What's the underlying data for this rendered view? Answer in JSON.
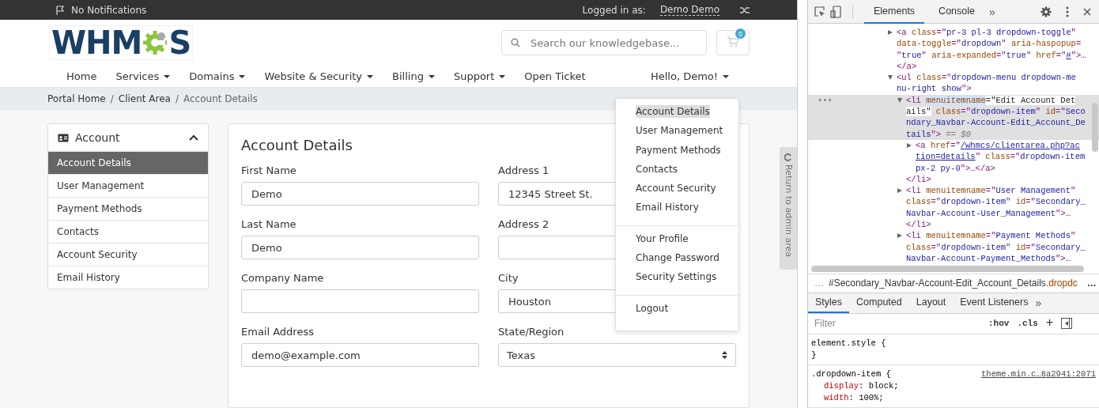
{
  "topbar": {
    "notifications": "No Notifications",
    "logged_in_label": "Logged in as:",
    "user": "Demo Demo"
  },
  "logo": {
    "before": "WHM",
    "after": "S"
  },
  "search": {
    "placeholder": "Search our knowledgebase..."
  },
  "cart": {
    "count": "0"
  },
  "nav": [
    {
      "label": "Home",
      "dropdown": false
    },
    {
      "label": "Services",
      "dropdown": true
    },
    {
      "label": "Domains",
      "dropdown": true
    },
    {
      "label": "Website & Security",
      "dropdown": true
    },
    {
      "label": "Billing",
      "dropdown": true
    },
    {
      "label": "Support",
      "dropdown": true
    },
    {
      "label": "Open Ticket",
      "dropdown": false
    }
  ],
  "account_menu": {
    "label": "Hello, Demo!",
    "expanded": true
  },
  "breadcrumb": {
    "separator": "/",
    "items": [
      {
        "label": "Portal Home",
        "current": false
      },
      {
        "label": "Client Area",
        "current": false
      },
      {
        "label": "Account Details",
        "current": true
      }
    ]
  },
  "sidebar": {
    "title": "Account",
    "expanded": true,
    "items": [
      {
        "label": "Account Details",
        "selected": true
      },
      {
        "label": "User Management",
        "selected": false
      },
      {
        "label": "Payment Methods",
        "selected": false
      },
      {
        "label": "Contacts",
        "selected": false
      },
      {
        "label": "Account Security",
        "selected": false
      },
      {
        "label": "Email History",
        "selected": false
      }
    ]
  },
  "form": {
    "title": "Account Details",
    "fields": [
      {
        "label": "First Name",
        "value": "Demo",
        "kind": "text"
      },
      {
        "label": "Address 1",
        "value": "12345 Street St.",
        "kind": "text"
      },
      {
        "label": "Last Name",
        "value": "Demo",
        "kind": "text"
      },
      {
        "label": "Address 2",
        "kind": "text"
      },
      {
        "label": "Company Name",
        "kind": "text"
      },
      {
        "label": "City",
        "value": "Houston",
        "kind": "text"
      },
      {
        "label": "Email Address",
        "value": "demo@example.com",
        "kind": "text"
      },
      {
        "label": "State/Region",
        "value": "Texas",
        "kind": "select"
      }
    ]
  },
  "dropdown_menu": [
    [
      {
        "label": "Account Details",
        "selected": true
      },
      {
        "label": "User Management",
        "selected": false
      },
      {
        "label": "Payment Methods",
        "selected": false
      },
      {
        "label": "Contacts",
        "selected": false
      },
      {
        "label": "Account Security",
        "selected": false
      },
      {
        "label": "Email History",
        "selected": false
      }
    ],
    [
      {
        "label": "Your Profile",
        "selected": false
      },
      {
        "label": "Change Password",
        "selected": false
      },
      {
        "label": "Security Settings",
        "selected": false
      }
    ],
    [
      {
        "label": "Logout",
        "selected": false
      }
    ]
  ],
  "admin_tab": "Return to admin area",
  "devtools": {
    "tabs": [
      {
        "label": "Elements",
        "selected": true
      },
      {
        "label": "Console",
        "selected": false
      }
    ],
    "more": "»",
    "dom": [
      {
        "expanded": false,
        "selected": false,
        "lines": [
          [
            {
              "kind": "tag",
              "t": "<a "
            },
            {
              "kind": "attr",
              "t": "class"
            },
            {
              "kind": "tag",
              "t": "=\""
            },
            {
              "kind": "val",
              "t": "pr-3 pl-3 dropdown-toggle"
            },
            {
              "kind": "tag",
              "t": "\""
            }
          ],
          [
            {
              "kind": "attr",
              "t": "data-toggle"
            },
            {
              "kind": "tag",
              "t": "=\""
            },
            {
              "kind": "val",
              "t": "dropdown"
            },
            {
              "kind": "tag",
              "t": "\" "
            },
            {
              "kind": "attr",
              "t": "aria-haspopup"
            },
            {
              "kind": "tag",
              "t": "="
            }
          ],
          [
            {
              "kind": "tag",
              "t": "\""
            },
            {
              "kind": "val",
              "t": "true"
            },
            {
              "kind": "tag",
              "t": "\" "
            },
            {
              "kind": "attr",
              "t": "aria-expanded"
            },
            {
              "kind": "tag",
              "t": "=\""
            },
            {
              "kind": "val",
              "t": "true"
            },
            {
              "kind": "tag",
              "t": "\" "
            },
            {
              "kind": "attr",
              "t": "href"
            },
            {
              "kind": "tag",
              "t": "=\""
            },
            {
              "kind": "link",
              "t": "#"
            },
            {
              "kind": "tag",
              "t": "\">…"
            }
          ]
        ],
        "closing": [
          {
            "kind": "tag",
            "t": "</a>"
          }
        ]
      },
      {
        "expanded": true,
        "selected": false,
        "lines": [
          [
            {
              "kind": "tag",
              "t": "<ul "
            },
            {
              "kind": "attr",
              "t": "class"
            },
            {
              "kind": "tag",
              "t": "=\""
            },
            {
              "kind": "val",
              "t": "dropdown-menu dropdown-me"
            }
          ],
          [
            {
              "kind": "val",
              "t": "nu-right show"
            },
            {
              "kind": "tag",
              "t": "\">"
            }
          ]
        ],
        "children": [
          {
            "expanded": true,
            "selected": true,
            "gutter": "•••",
            "lines": [
              [
                {
                  "kind": "tag",
                  "t": "<li "
                },
                {
                  "kind": "edit-attr",
                  "t": "menuitemname"
                },
                {
                  "kind": "edit",
                  "t": "=\"Edit Account Det"
                }
              ],
              [
                {
                  "kind": "edit",
                  "t": "ails\""
                },
                {
                  "kind": "attr",
                  "t": " class"
                },
                {
                  "kind": "tag",
                  "t": "=\""
                },
                {
                  "kind": "val",
                  "t": "dropdown-item"
                },
                {
                  "kind": "tag",
                  "t": "\" "
                },
                {
                  "kind": "attr",
                  "t": "id"
                },
                {
                  "kind": "tag",
                  "t": "=\""
                },
                {
                  "kind": "val",
                  "t": "Seco"
                }
              ],
              [
                {
                  "kind": "val",
                  "t": "ndary_Navbar-Account-Edit_Account_De"
                }
              ],
              [
                {
                  "kind": "val",
                  "t": "tails"
                },
                {
                  "kind": "tag",
                  "t": "\">"
                },
                {
                  "kind": "note",
                  "t": " == $0"
                }
              ]
            ],
            "closing": [
              {
                "kind": "tag",
                "t": "</li>"
              }
            ],
            "children": [
              {
                "expanded": false,
                "selected": false,
                "lines": [
                  [
                    {
                      "kind": "tag",
                      "t": "<a "
                    },
                    {
                      "kind": "attr",
                      "t": "href"
                    },
                    {
                      "kind": "tag",
                      "t": "=\""
                    },
                    {
                      "kind": "link",
                      "t": "/whmcs/clientarea.php?ac"
                    }
                  ],
                  [
                    {
                      "kind": "link",
                      "t": "tion=details"
                    },
                    {
                      "kind": "tag",
                      "t": "\" "
                    },
                    {
                      "kind": "attr",
                      "t": "class"
                    },
                    {
                      "kind": "tag",
                      "t": "=\""
                    },
                    {
                      "kind": "val",
                      "t": "dropdown-item"
                    }
                  ],
                  [
                    {
                      "kind": "val",
                      "t": "px-2 py-0"
                    },
                    {
                      "kind": "tag",
                      "t": "\">…</a>"
                    }
                  ]
                ]
              }
            ]
          },
          {
            "expanded": false,
            "selected": false,
            "lines": [
              [
                {
                  "kind": "tag",
                  "t": "<li "
                },
                {
                  "kind": "attr",
                  "t": "menuitemname"
                },
                {
                  "kind": "tag",
                  "t": "=\""
                },
                {
                  "kind": "val",
                  "t": "User Management"
                },
                {
                  "kind": "tag",
                  "t": "\""
                }
              ],
              [
                {
                  "kind": "attr",
                  "t": "class"
                },
                {
                  "kind": "tag",
                  "t": "=\""
                },
                {
                  "kind": "val",
                  "t": "dropdown-item"
                },
                {
                  "kind": "tag",
                  "t": "\" "
                },
                {
                  "kind": "attr",
                  "t": "id"
                },
                {
                  "kind": "tag",
                  "t": "=\""
                },
                {
                  "kind": "val",
                  "t": "Secondary_"
                }
              ],
              [
                {
                  "kind": "val",
                  "t": "Navbar-Account-User_Management"
                },
                {
                  "kind": "tag",
                  "t": "\">…"
                }
              ]
            ],
            "closing": [
              {
                "kind": "tag",
                "t": "</li>"
              }
            ]
          },
          {
            "expanded": false,
            "selected": false,
            "lines": [
              [
                {
                  "kind": "tag",
                  "t": "<li "
                },
                {
                  "kind": "attr",
                  "t": "menuitemname"
                },
                {
                  "kind": "tag",
                  "t": "=\""
                },
                {
                  "kind": "val",
                  "t": "Payment Methods"
                },
                {
                  "kind": "tag",
                  "t": "\""
                }
              ],
              [
                {
                  "kind": "attr",
                  "t": "class"
                },
                {
                  "kind": "tag",
                  "t": "=\""
                },
                {
                  "kind": "val",
                  "t": "dropdown-item"
                },
                {
                  "kind": "tag",
                  "t": "\" "
                },
                {
                  "kind": "attr",
                  "t": "id"
                },
                {
                  "kind": "tag",
                  "t": "=\""
                },
                {
                  "kind": "val",
                  "t": "Secondary_"
                }
              ],
              [
                {
                  "kind": "val",
                  "t": "Navbar-Account-Payment_Methods"
                },
                {
                  "kind": "tag",
                  "t": "\">…"
                }
              ]
            ]
          }
        ]
      }
    ],
    "crumb": {
      "prefix": "…",
      "id": "#Secondary_Navbar-Account-Edit_Account_Details",
      "cls": ".dropdc",
      "suffix": "…"
    },
    "style_tabs": [
      {
        "label": "Styles",
        "selected": true
      },
      {
        "label": "Computed",
        "selected": false
      },
      {
        "label": "Layout",
        "selected": false
      },
      {
        "label": "Event Listeners",
        "selected": false
      }
    ],
    "style_more": "»",
    "filter": {
      "placeholder": "Filter"
    },
    "hov": ":hov",
    "cls": ".cls",
    "add": "+",
    "rules": [
      {
        "selector": "element.style {",
        "close": "}"
      },
      {
        "selector": ".dropdown-item {",
        "source": "theme.min.c…8a2941:2071",
        "decls": [
          {
            "prop": "display",
            "colon": ":",
            "value": "block;"
          },
          {
            "prop": "width",
            "colon": ":",
            "value": "100%;"
          }
        ]
      }
    ]
  }
}
